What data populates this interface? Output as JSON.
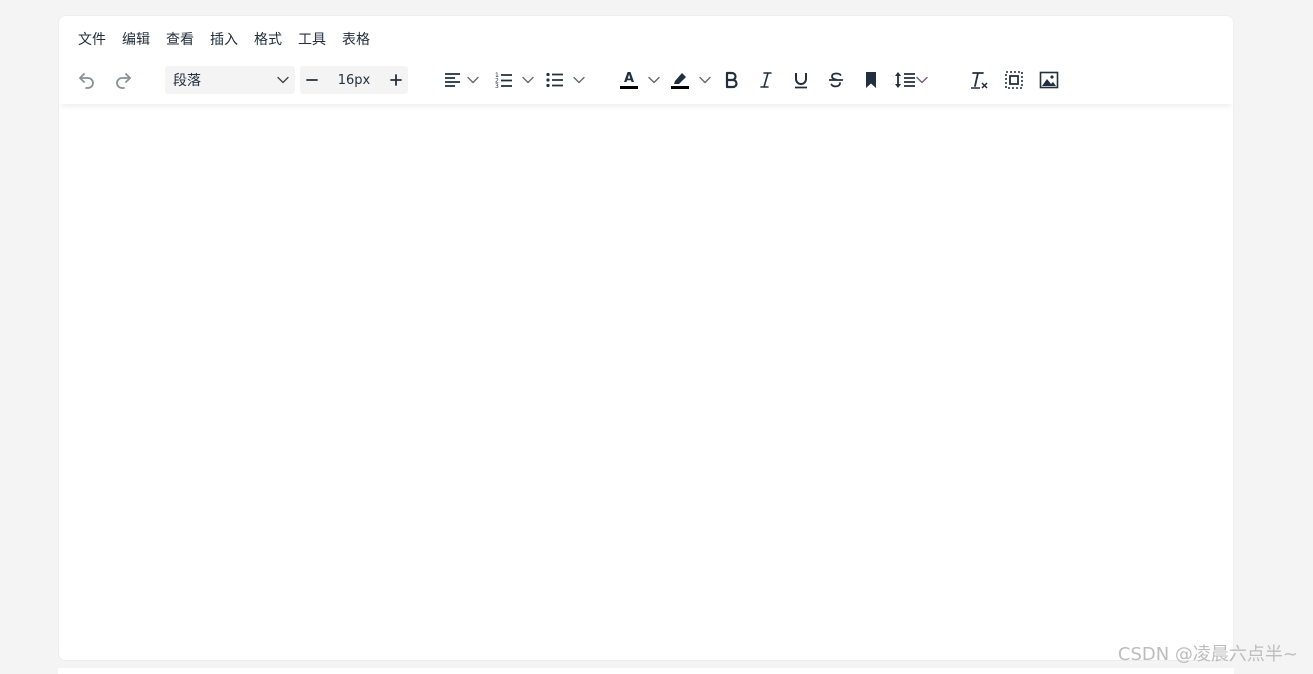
{
  "menubar": {
    "items": [
      "文件",
      "编辑",
      "查看",
      "插入",
      "格式",
      "工具",
      "表格"
    ]
  },
  "toolbar": {
    "block_format": {
      "value": "段落"
    },
    "font_size": {
      "value": "16px"
    },
    "colors": {
      "icon": "#222f3e",
      "icon_disabled": "#8a8f96",
      "text_color_bar": "#000000",
      "highlight_bar": "#000000"
    },
    "icons": [
      "undo-icon",
      "redo-icon",
      "chevron-down-icon",
      "minus-icon",
      "plus-icon",
      "align-left-icon",
      "ordered-list-icon",
      "bullet-list-icon",
      "text-color-icon",
      "highlight-icon",
      "bold-icon",
      "italic-icon",
      "underline-icon",
      "strikethrough-icon",
      "bookmark-icon",
      "line-height-icon",
      "remove-format-icon",
      "select-all-icon",
      "image-icon"
    ]
  },
  "editor": {
    "content": ""
  },
  "watermark": "CSDN @凌晨六点半~"
}
